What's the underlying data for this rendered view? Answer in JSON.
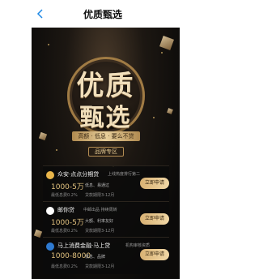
{
  "header": {
    "title": "优质甄选",
    "back_icon": "chevron-left-icon"
  },
  "hero": {
    "line1": "优质",
    "line2": "甄选",
    "tagline": "高额 · 低息 · 要么不贷",
    "sublabel": "品牌专区"
  },
  "products": [
    {
      "name": "众安·点点分期贷",
      "badge": "上线热度排行第二",
      "amount": "1000-5万",
      "tags": "低息、易通过",
      "rate": "最低息费0.2%",
      "term": "贷款期限3-12月",
      "apply_label": "立即申请"
    },
    {
      "name": "邮你贷",
      "badge": "中邮出品 持续周转",
      "amount": "1000-5万",
      "tags": "大额、利率友好",
      "rate": "最低息费0.2%",
      "term": "贷款期限3-12月",
      "apply_label": "立即申请"
    },
    {
      "name": "马上消费金融·马上贷",
      "badge": "机构审核资质",
      "amount": "1000-8000",
      "tags": "低息、品牌",
      "rate": "最低息费0.2%",
      "term": "贷款期限3-12月",
      "apply_label": "立即申请"
    }
  ],
  "colors": {
    "accent_gold": "#e2c27f",
    "background_dark": "#0b0a09"
  }
}
